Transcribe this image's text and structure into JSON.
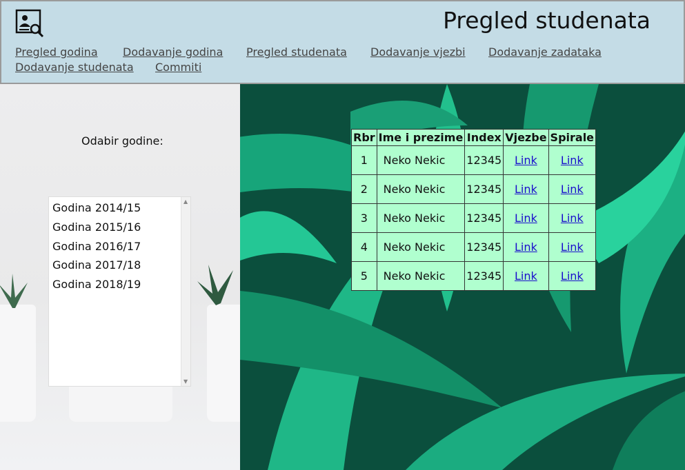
{
  "header": {
    "title": "Pregled studenata",
    "logo_icon": "student-search-icon",
    "nav": [
      {
        "label": "Pregled godina"
      },
      {
        "label": "Dodavanje godina"
      },
      {
        "label": "Pregled studenata"
      },
      {
        "label": "Dodavanje vjezbi"
      },
      {
        "label": "Dodavanje zadataka"
      },
      {
        "label": "Dodavanje studenata"
      },
      {
        "label": "Commiti"
      }
    ]
  },
  "sidebar": {
    "label": "Odabir godine:",
    "years": [
      "Godina 2014/15",
      "Godina 2015/16",
      "Godina 2016/17",
      "Godina 2017/18",
      "Godina 2018/19"
    ]
  },
  "table": {
    "headers": [
      "Rbr",
      "Ime i prezime",
      "Index",
      "Vjezbe",
      "Spirale"
    ],
    "rows": [
      {
        "rbr": "1",
        "name": "Neko Nekic",
        "index": "12345",
        "vjezbe": "Link",
        "spirale": "Link"
      },
      {
        "rbr": "2",
        "name": "Neko Nekic",
        "index": "12345",
        "vjezbe": "Link",
        "spirale": "Link"
      },
      {
        "rbr": "3",
        "name": "Neko Nekic",
        "index": "12345",
        "vjezbe": "Link",
        "spirale": "Link"
      },
      {
        "rbr": "4",
        "name": "Neko Nekic",
        "index": "12345",
        "vjezbe": "Link",
        "spirale": "Link"
      },
      {
        "rbr": "5",
        "name": "Neko Nekic",
        "index": "12345",
        "vjezbe": "Link",
        "spirale": "Link"
      }
    ]
  },
  "colors": {
    "header_bg": "#c4dce6",
    "table_bg": "#b0ffcf",
    "link": "#1a0dcc"
  }
}
